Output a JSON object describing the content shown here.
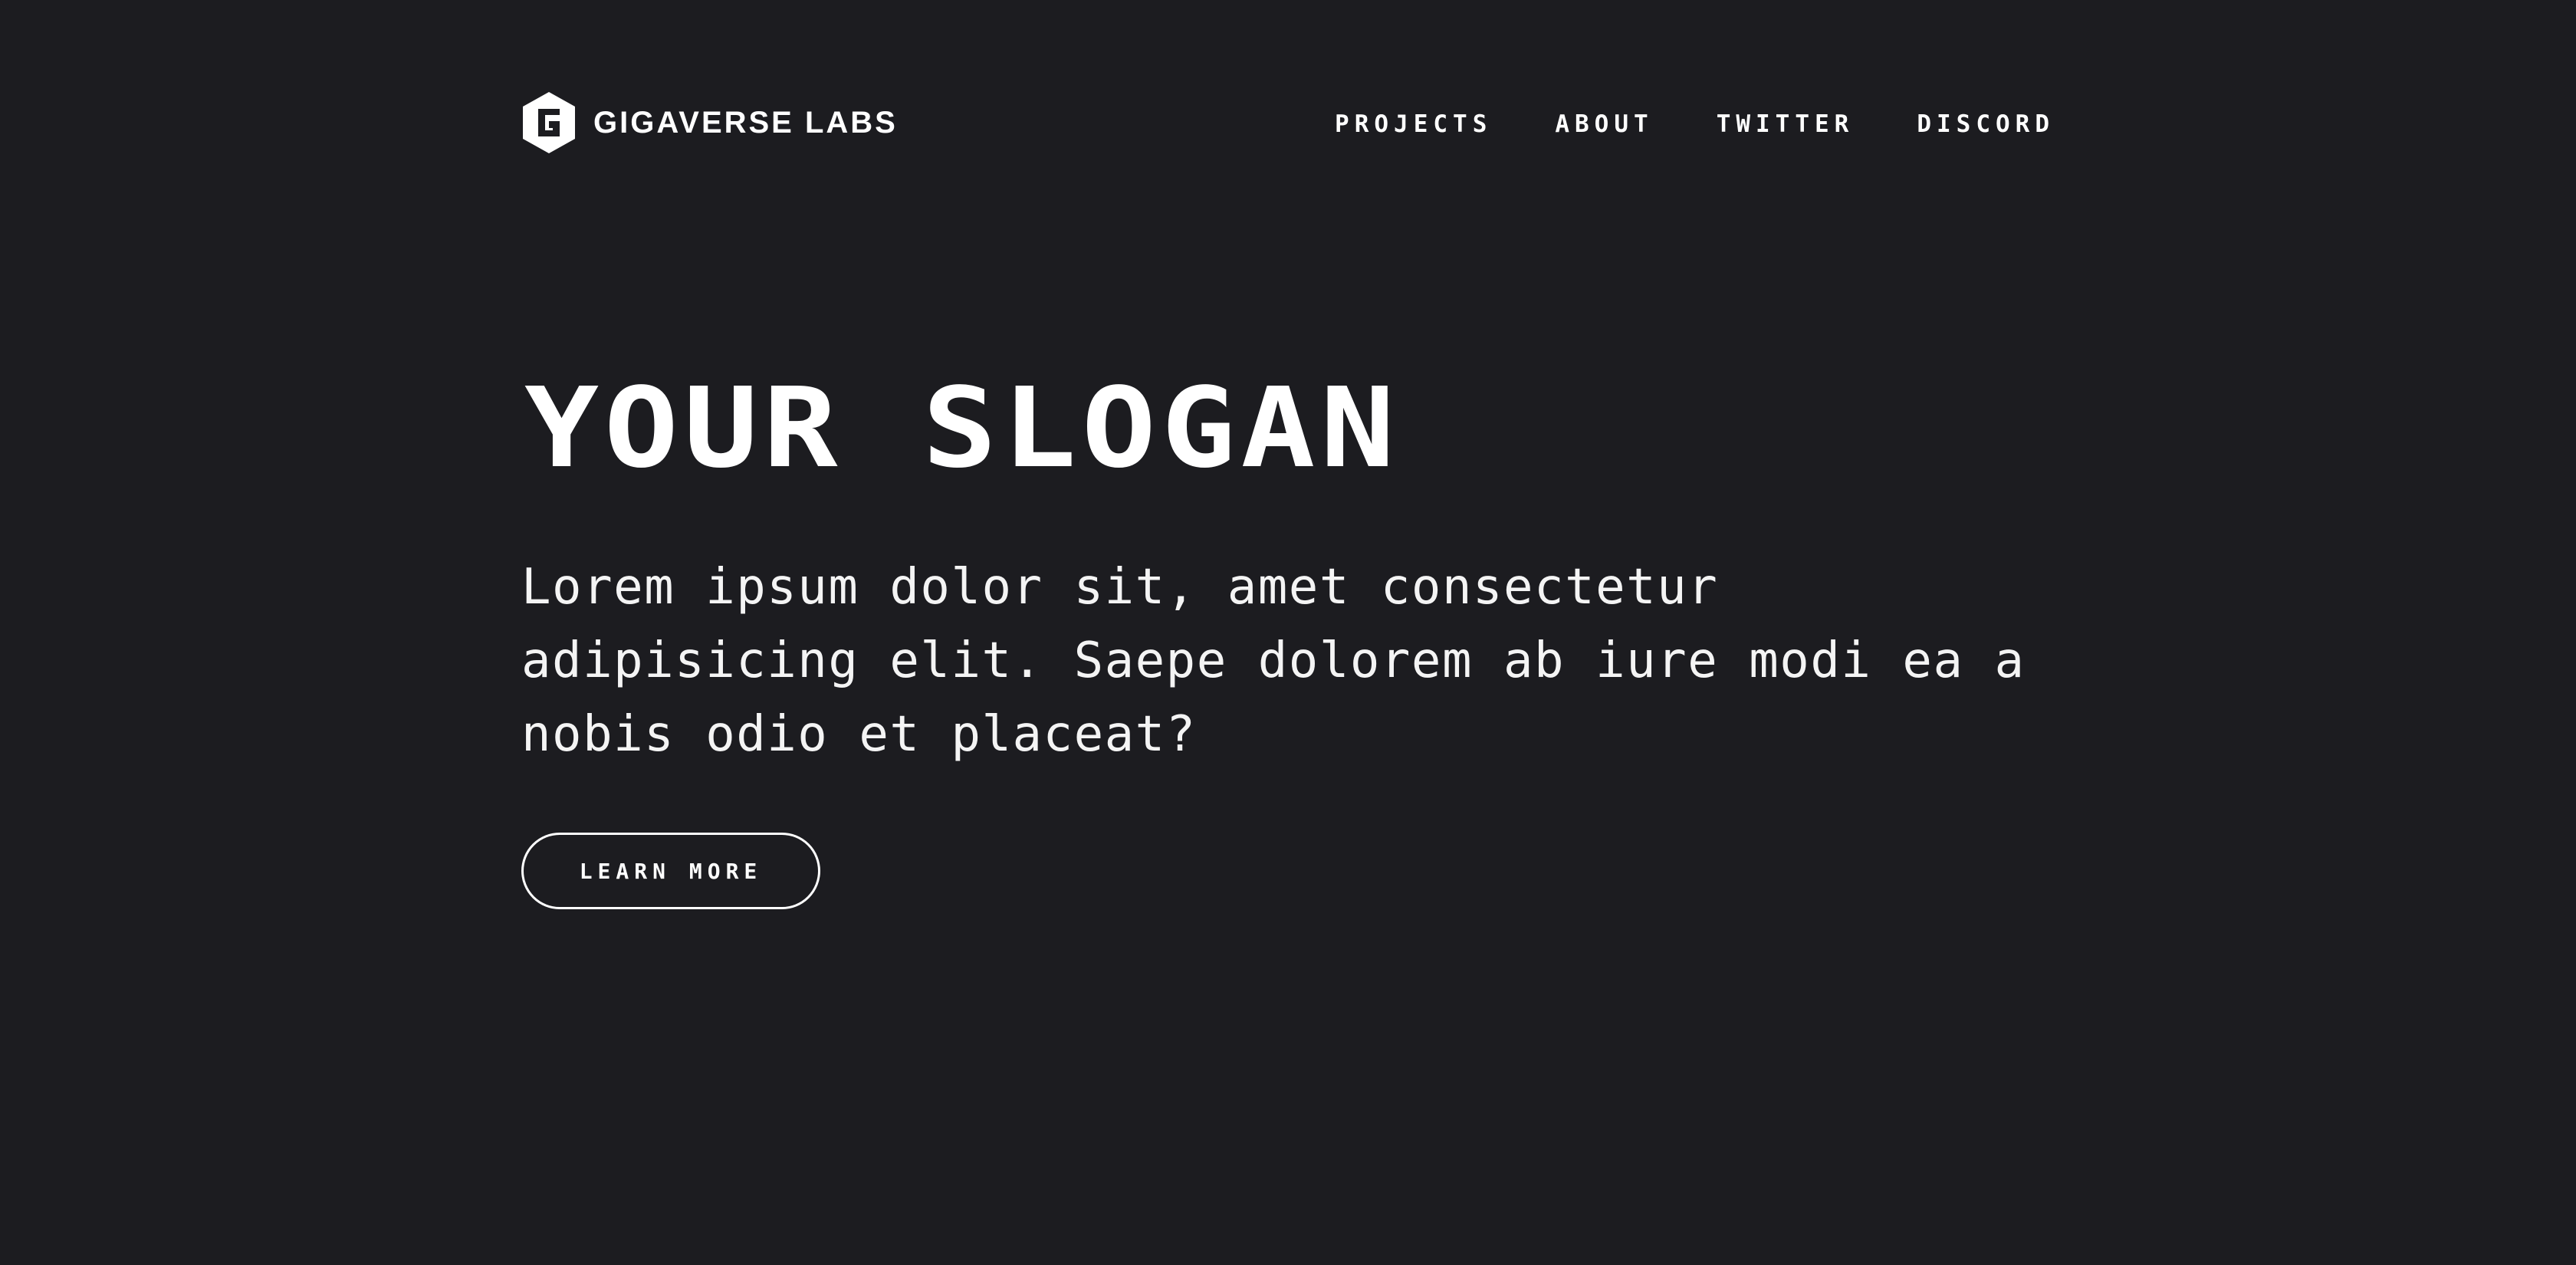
{
  "header": {
    "brand_name": "GIGAVERSE LABS",
    "logo_icon": "hexagon-g-icon",
    "nav": [
      {
        "label": "PROJECTS"
      },
      {
        "label": "ABOUT"
      },
      {
        "label": "TWITTER"
      },
      {
        "label": "DISCORD"
      }
    ]
  },
  "hero": {
    "title": "YOUR SLOGAN",
    "description": "Lorem ipsum dolor sit, amet consectetur adipisicing elit. Saepe dolorem ab iure modi ea a nobis odio et placeat?",
    "cta_label": "LEARN MORE"
  },
  "colors": {
    "background": "#1c1c20",
    "text": "#ffffff"
  }
}
